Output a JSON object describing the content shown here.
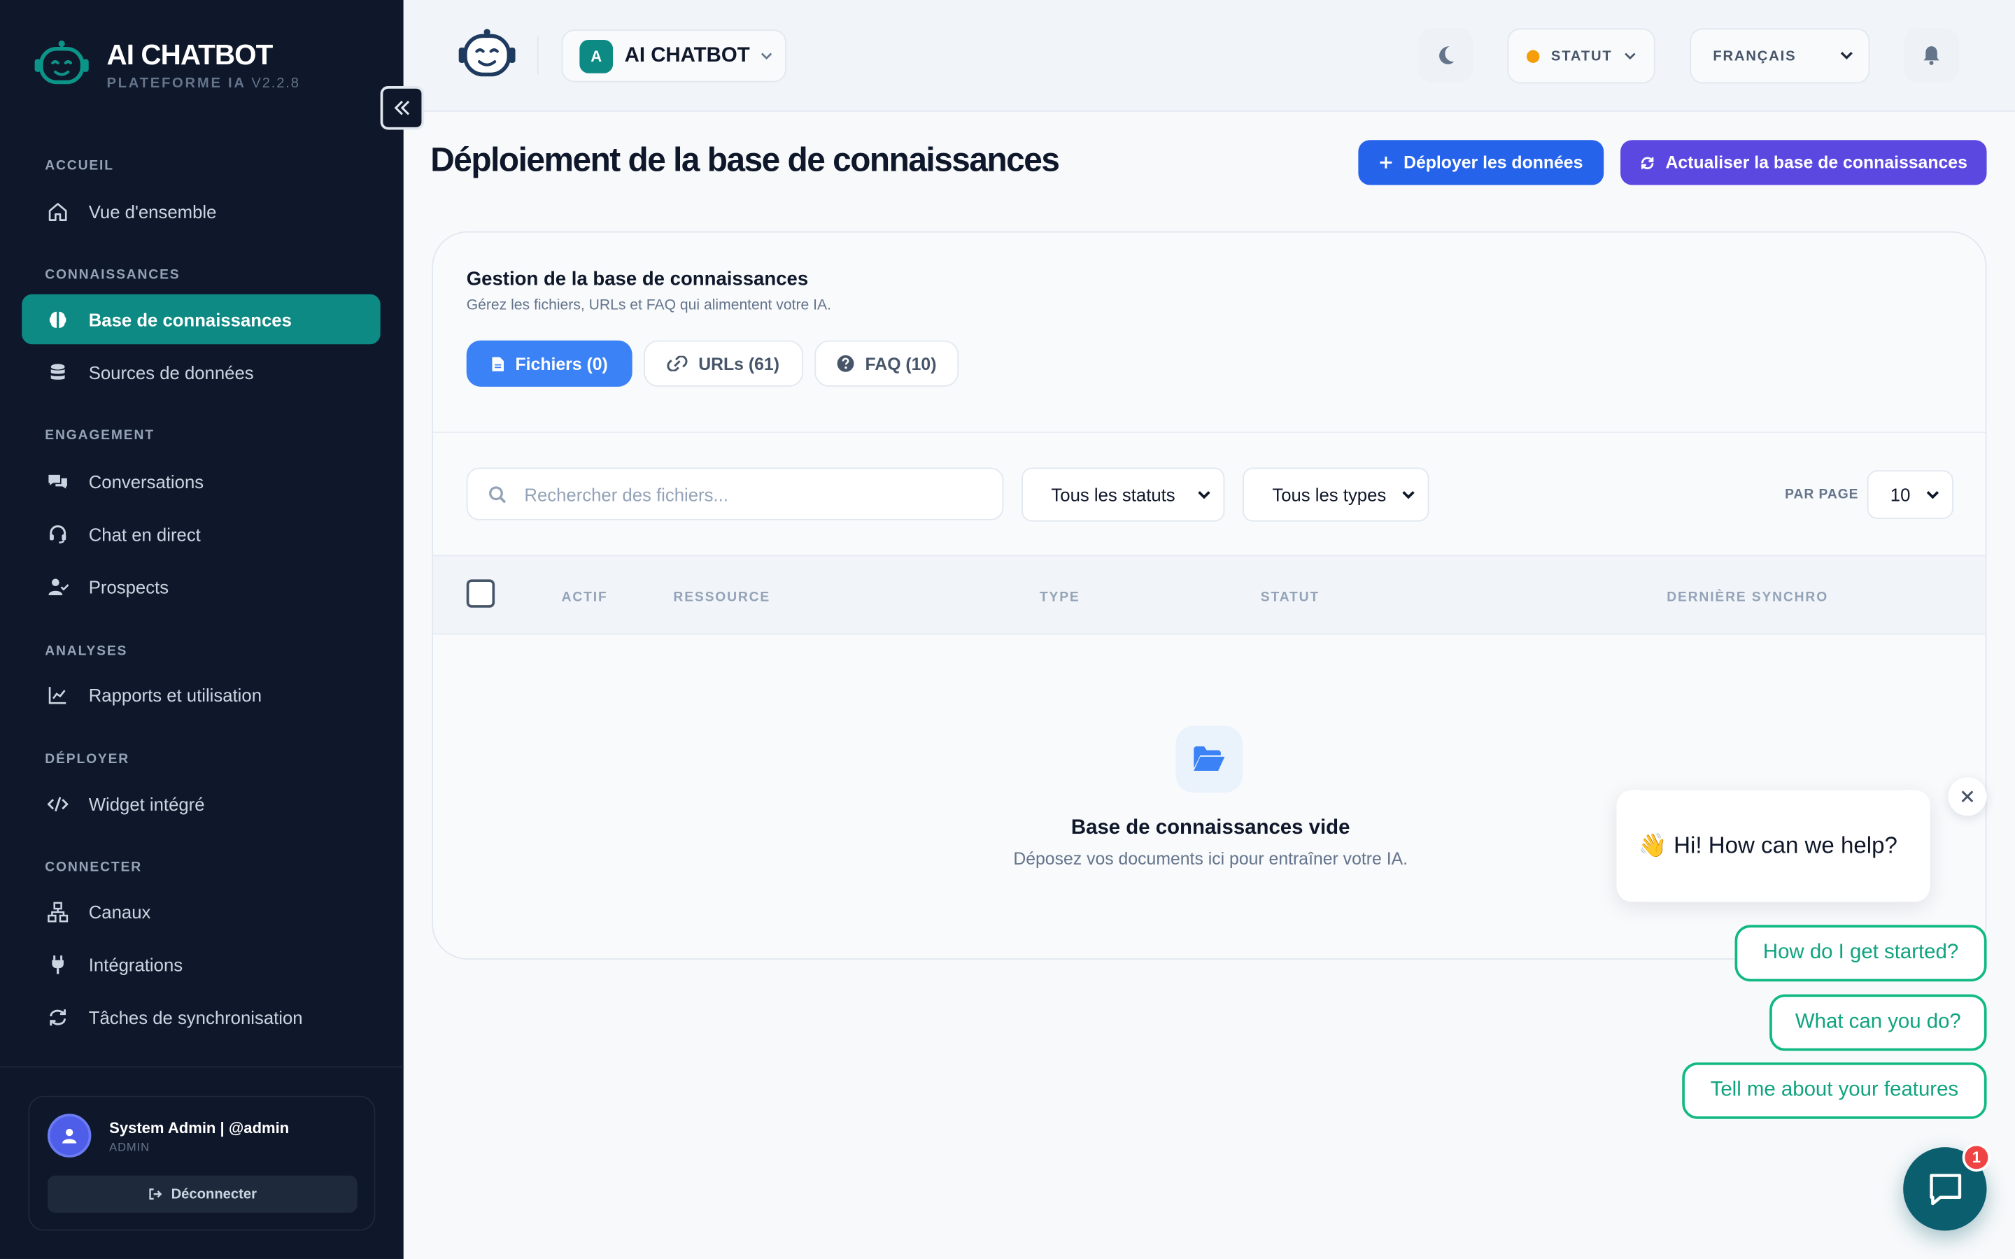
{
  "brand": {
    "title": "AI CHATBOT",
    "subtitle": "PLATEFORME IA",
    "version": "V2.2.8"
  },
  "sidebar": {
    "sections": [
      {
        "label": "ACCUEIL",
        "items": [
          {
            "label": "Vue d'ensemble",
            "icon": "home-icon"
          }
        ]
      },
      {
        "label": "CONNAISSANCES",
        "items": [
          {
            "label": "Base de connaissances",
            "icon": "brain-icon",
            "active": true
          },
          {
            "label": "Sources de données",
            "icon": "database-icon"
          }
        ]
      },
      {
        "label": "ENGAGEMENT",
        "items": [
          {
            "label": "Conversations",
            "icon": "comments-icon"
          },
          {
            "label": "Chat en direct",
            "icon": "headset-icon"
          },
          {
            "label": "Prospects",
            "icon": "users-icon"
          }
        ]
      },
      {
        "label": "ANALYSES",
        "items": [
          {
            "label": "Rapports et utilisation",
            "icon": "chart-line-icon"
          }
        ]
      },
      {
        "label": "DÉPLOYER",
        "items": [
          {
            "label": "Widget intégré",
            "icon": "code-icon"
          }
        ]
      },
      {
        "label": "CONNECTER",
        "items": [
          {
            "label": "Canaux",
            "icon": "network-icon"
          },
          {
            "label": "Intégrations",
            "icon": "plug-icon"
          },
          {
            "label": "Tâches de synchronisation",
            "icon": "sync-icon"
          }
        ]
      }
    ]
  },
  "user": {
    "name": "System Admin | @admin",
    "role": "ADMIN",
    "logout_label": "Déconnecter"
  },
  "header": {
    "workspace_initial": "A",
    "workspace_name": "AI CHATBOT",
    "status_label": "STATUT",
    "status_color": "#f59e0b",
    "language": "FRANÇAIS"
  },
  "page": {
    "title": "Déploiement de la base de connaissances",
    "deploy_label": "Déployer les données",
    "refresh_label": "Actualiser la base de connaissances"
  },
  "card": {
    "title": "Gestion de la base de connaissances",
    "subtitle": "Gérez les fichiers, URLs et FAQ qui alimentent votre IA.",
    "tabs": [
      {
        "label": "Fichiers (0)",
        "icon": "file-icon",
        "active": true
      },
      {
        "label": "URLs (61)",
        "icon": "link-icon"
      },
      {
        "label": "FAQ (10)",
        "icon": "question-circle-icon"
      }
    ],
    "search_placeholder": "Rechercher des fichiers...",
    "status_filter": "Tous les statuts",
    "type_filter": "Tous les types",
    "per_page_label": "PAR PAGE",
    "per_page_value": "10",
    "columns": [
      "ACTIF",
      "RESSOURCE",
      "TYPE",
      "STATUT",
      "DERNIÈRE SYNCHRO"
    ],
    "empty_title": "Base de connaissances vide",
    "empty_subtitle": "Déposez vos documents ici pour entraîner votre IA."
  },
  "chat_widget": {
    "greeting": "👋 Hi! How can we help?",
    "quick_replies": [
      "How do I get started?",
      "What can you do?",
      "Tell me about your features"
    ],
    "badge_count": "1"
  },
  "colors": {
    "accent": "#0d8a84",
    "primary": "#2563eb",
    "secondary": "#5b48e0",
    "chat_green": "#10b981",
    "launcher": "#0b5e6e"
  }
}
